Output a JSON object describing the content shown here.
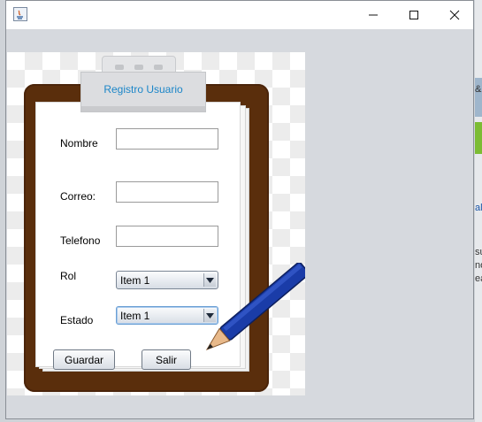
{
  "window": {
    "controls": [
      "minimize",
      "maximize",
      "close"
    ]
  },
  "form": {
    "title": "Registro Usuario",
    "fields": [
      {
        "label": "Nombre",
        "value": ""
      },
      {
        "label": "Correo:",
        "value": ""
      },
      {
        "label": "Telefono",
        "value": ""
      }
    ],
    "rol": {
      "label": "Rol",
      "selected": "Item 1"
    },
    "estado": {
      "label": "Estado",
      "selected": "Item 1"
    },
    "buttons": {
      "save": "Guardar",
      "exit": "Salir"
    }
  },
  "background_fragments": [
    "&",
    "al",
    "su",
    "no",
    "ea"
  ],
  "colors": {
    "title_text": "#1c86c8",
    "board": "#5a2e0c",
    "pencil": "#1a3ca8"
  },
  "icons": [
    "java-app-icon",
    "minimize-icon",
    "maximize-icon",
    "close-icon",
    "dropdown-arrow-icon",
    "pencil-icon",
    "clipboard-icon"
  ]
}
